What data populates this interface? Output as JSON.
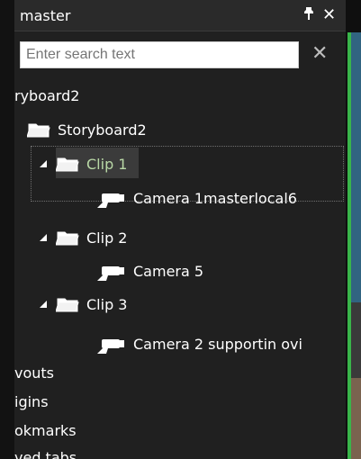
{
  "panel": {
    "title": "master",
    "pin_icon": "pin-icon",
    "close_icon": "close-icon"
  },
  "search": {
    "placeholder": "Enter search text",
    "clear_icon": "clear-search-icon"
  },
  "tree": {
    "root_label_cropped": "ryboard2",
    "storyboard": {
      "label": "Storyboard2"
    },
    "clips": [
      {
        "label": "Clip 1",
        "camera": "Camera 1masterlocal6"
      },
      {
        "label": "Clip 2",
        "camera": "Camera 5"
      },
      {
        "label": "Clip 3",
        "camera": "Camera 2 supportin ovi"
      }
    ],
    "other_sections_cropped": [
      "vouts",
      "igins",
      "okmarks",
      "ved tabs"
    ]
  },
  "colors": {
    "panel_bg": "#202020",
    "titlebar_bg": "#2a2a2a",
    "selected_clip_text": "#b9d8a6",
    "accent_green": "#39b54a"
  }
}
